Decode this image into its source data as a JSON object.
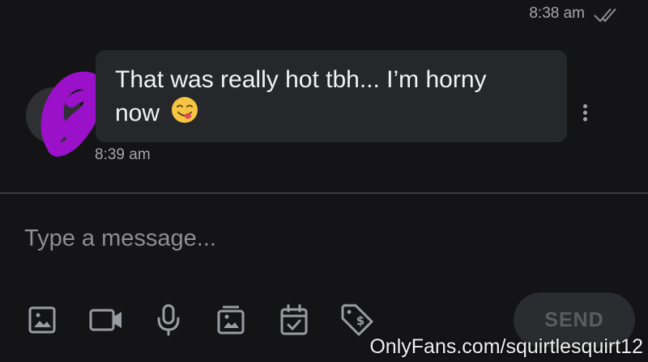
{
  "previous_message": {
    "time": "8:38 am",
    "status_icon": "double-check-icon"
  },
  "incoming_message": {
    "text_line1": "That was really hot tbh... I’m horny",
    "text_line2": "now",
    "emoji": "face-savoring-food-emoji",
    "time": "8:39 am"
  },
  "composer": {
    "placeholder": "Type a message...",
    "value": ""
  },
  "toolbar": {
    "icons": [
      "image-icon",
      "video-icon",
      "microphone-icon",
      "gallery-vault-icon",
      "calendar-check-icon",
      "price-tag-icon"
    ],
    "send_label": "SEND"
  },
  "watermark": "OnlyFans.com/squirtlesquirt12",
  "colors": {
    "background": "#141416",
    "bubble": "#26272b",
    "muted_text": "#a4a5a9",
    "icon": "#9a9ca3",
    "scribble": "#9b10c9"
  }
}
